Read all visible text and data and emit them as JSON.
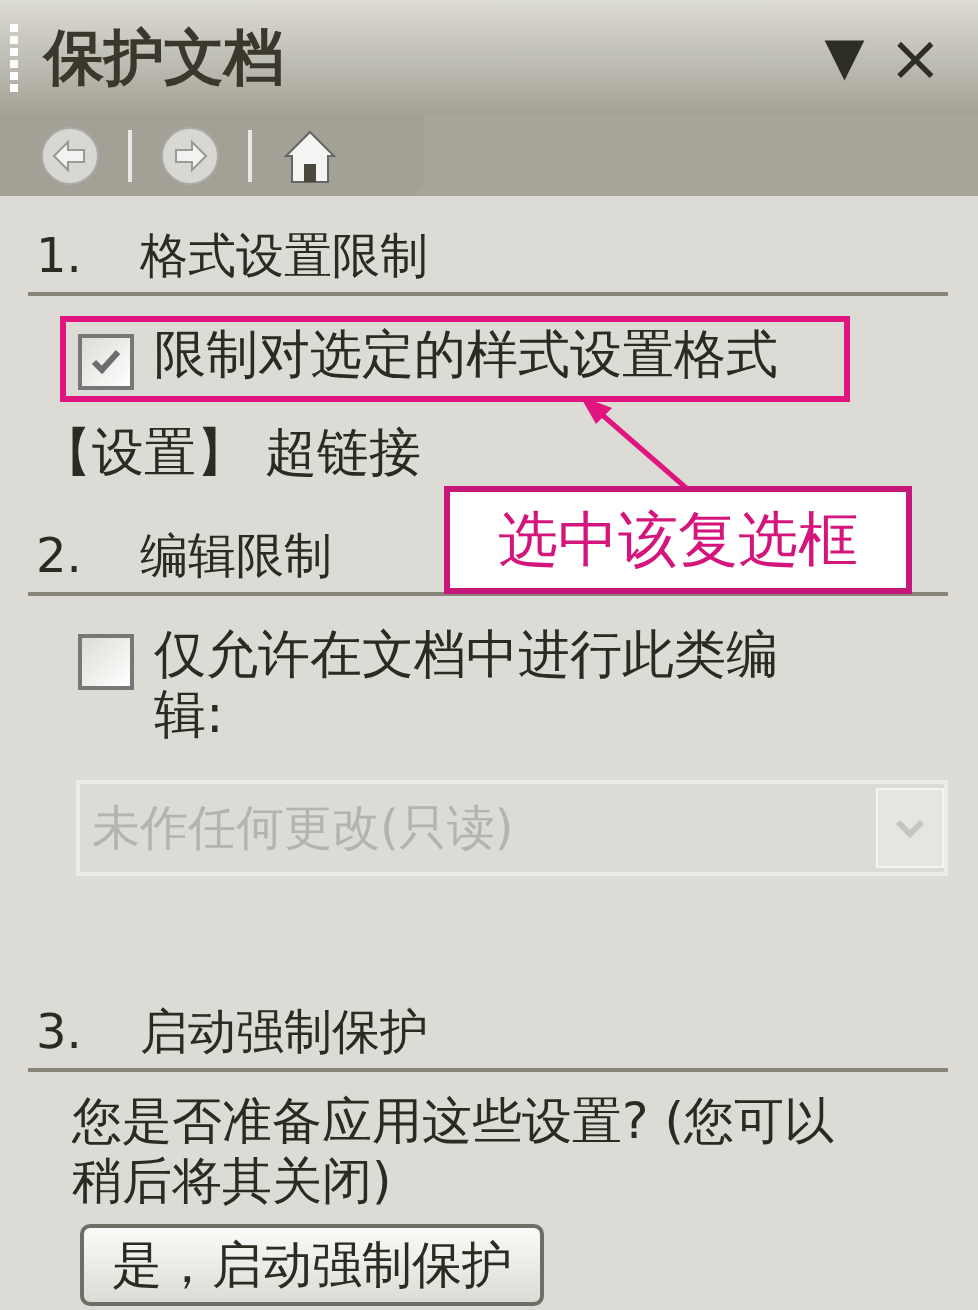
{
  "pane": {
    "title": "保护文档",
    "menu_glyph": "▼",
    "close_glyph": "×"
  },
  "nav_buttons": [
    {
      "kind": "back"
    },
    {
      "kind": "forward"
    },
    {
      "kind": "home"
    }
  ],
  "sections": [
    {
      "number": "1.",
      "title": "格式设置限制",
      "items": [
        {
          "kind": "checkbox",
          "label": "限制对选定的样式设置格式",
          "checked": true,
          "highlighted": true
        },
        {
          "kind": "link",
          "label": "【设置】 超链接"
        }
      ]
    },
    {
      "number": "2.",
      "title": "编辑限制",
      "items": [
        {
          "kind": "checkbox",
          "label": "仅允许在文档中进行此类编辑:",
          "checked": false,
          "highlighted": false
        },
        {
          "kind": "dropdown",
          "value": "未作任何更改(只读)",
          "disabled": true
        }
      ]
    },
    {
      "number": "3.",
      "title": "启动强制保护",
      "items": [
        {
          "kind": "text",
          "label": "您是否准备应用这些设置? (您可以稍后将其关闭)"
        },
        {
          "kind": "button",
          "label": "是，启动强制保护"
        }
      ]
    }
  ],
  "callout": {
    "text": "选中该复选框"
  }
}
